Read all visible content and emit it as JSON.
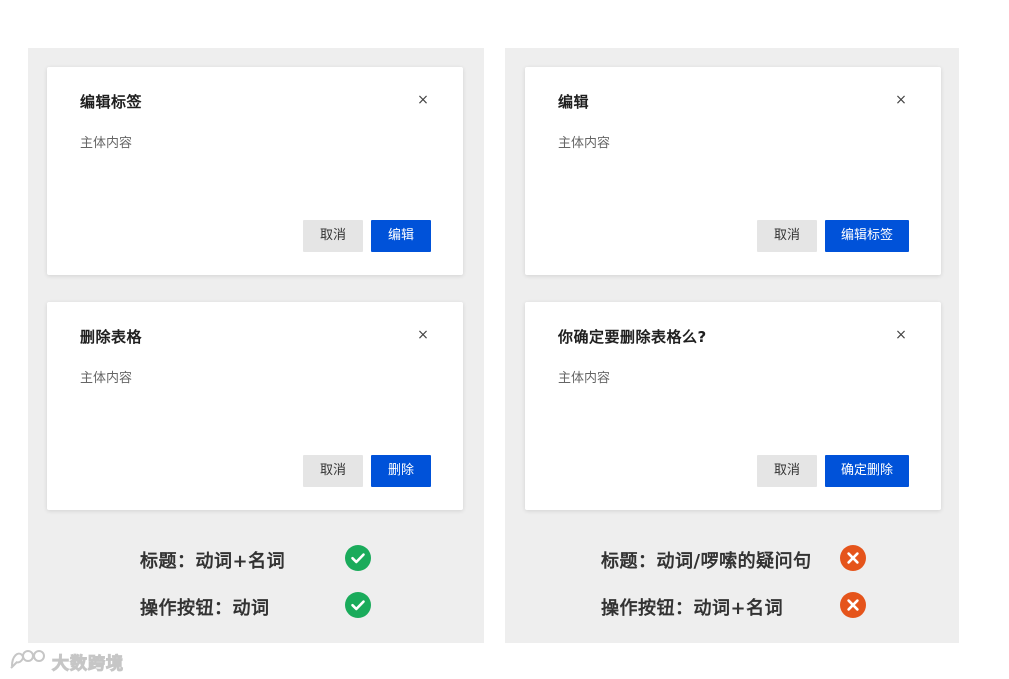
{
  "left_panel": {
    "dialog_top": {
      "title": "编辑标签",
      "close_glyph": "×",
      "body": "主体内容",
      "cancel_label": "取消",
      "confirm_label": "编辑"
    },
    "dialog_bottom": {
      "title": "删除表格",
      "close_glyph": "×",
      "body": "主体内容",
      "cancel_label": "取消",
      "confirm_label": "删除"
    },
    "rules": [
      {
        "text": "标题：动词+名词",
        "status": "correct"
      },
      {
        "text": "操作按钮：动词",
        "status": "correct"
      }
    ]
  },
  "right_panel": {
    "dialog_top": {
      "title": "编辑",
      "close_glyph": "×",
      "body": "主体内容",
      "cancel_label": "取消",
      "confirm_label": "编辑标签"
    },
    "dialog_bottom": {
      "title": "你确定要删除表格么?",
      "close_glyph": "×",
      "body": "主体内容",
      "cancel_label": "取消",
      "confirm_label": "确定删除"
    },
    "rules": [
      {
        "text": "标题：动词/啰嗦的疑问句",
        "status": "wrong"
      },
      {
        "text": "操作按钮：动词+名词",
        "status": "wrong"
      }
    ]
  },
  "watermark": {
    "text": "大数跨境",
    "icon": "logo-icon"
  },
  "colors": {
    "primary": "#0052d9",
    "correct": "#1aab5b",
    "wrong": "#e5541b",
    "panel_bg": "#eeeeee"
  }
}
